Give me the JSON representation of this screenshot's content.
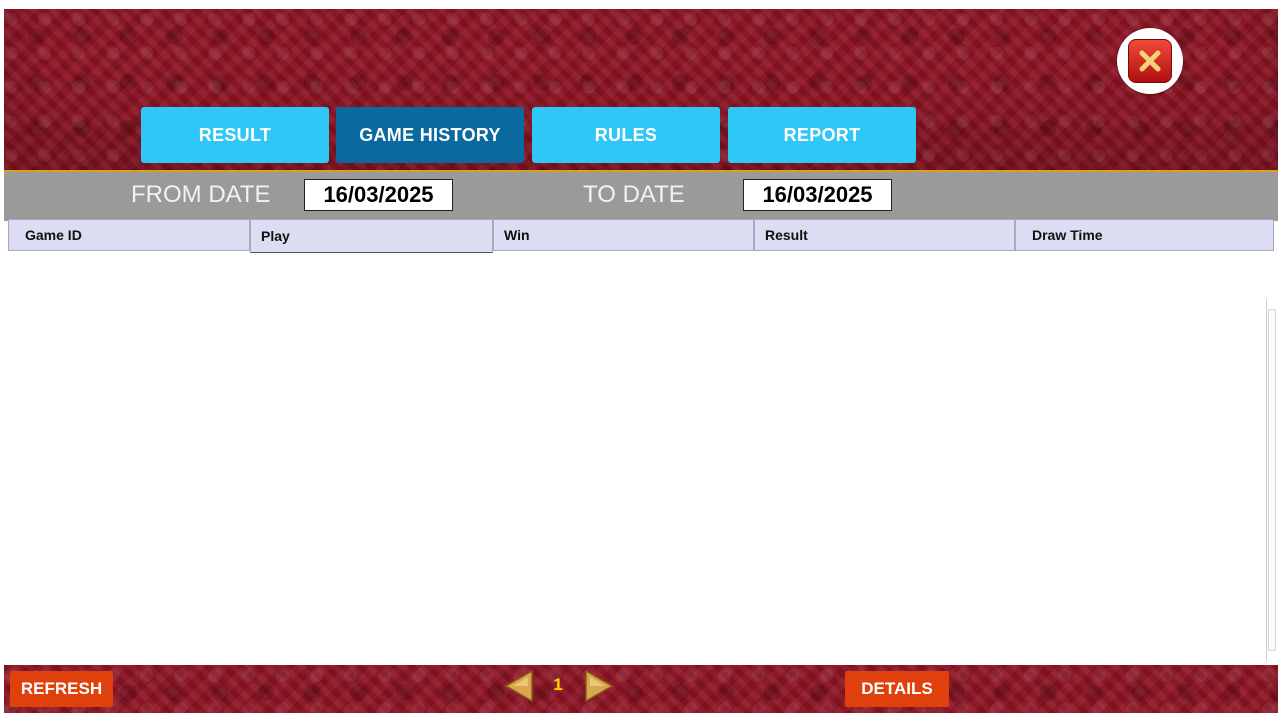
{
  "header": {
    "tabs": [
      {
        "label": "RESULT",
        "active": false
      },
      {
        "label": "GAME HISTORY",
        "active": true
      },
      {
        "label": "RULES",
        "active": false
      },
      {
        "label": "REPORT",
        "active": false
      }
    ]
  },
  "date_filter": {
    "from_label": "FROM DATE",
    "from_value": "16/03/2025",
    "to_label": "TO DATE",
    "to_value": "16/03/2025"
  },
  "table": {
    "columns": [
      "Game ID",
      "Play",
      "Win",
      "Result",
      "Draw Time"
    ],
    "rows": []
  },
  "footer": {
    "refresh_label": "REFRESH",
    "page": "1",
    "details_label": "DETAILS"
  },
  "icons": {
    "close": "close-icon",
    "prev": "arrow-left-icon",
    "next": "arrow-right-icon"
  },
  "colors": {
    "background": "#8e1424",
    "tab": "#2ec7f7",
    "tab_active": "#0a6aa0",
    "footer_button": "#e0400c",
    "page_number": "#ffd400"
  }
}
